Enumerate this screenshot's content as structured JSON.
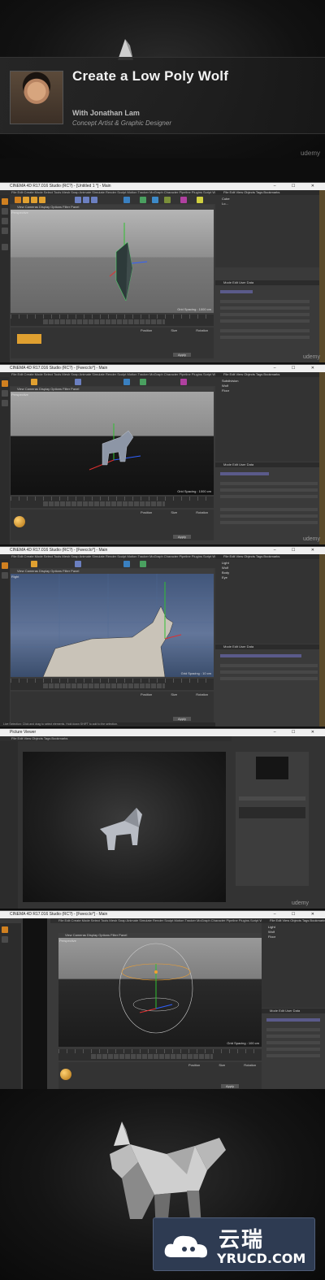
{
  "header": {
    "course_title": "Create a Low Poly Wolf",
    "instructor_line": "With Jonathan Lam",
    "instructor_role": "Concept Artist & Graphic Designer",
    "brand": "udemy"
  },
  "windows": [
    {
      "title": "CINEMA 4D R17.016 Studio (RC?) - [Untitled 1 *] - Main",
      "viewport_label": "Perspective",
      "grid_spacing": "Grid Spacing : 1000 cm",
      "om_rows": [
        "Cube",
        "Lo..."
      ],
      "brand": "udemy"
    },
    {
      "title": "CINEMA 4D R17.016 Studio (RC?) - [Fwecclo*] - Main",
      "viewport_label": "Perspective",
      "grid_spacing": "Grid Spacing : 1000 cm",
      "om_rows": [
        "Subdivision",
        "Wolf",
        "Floor"
      ],
      "brand": "udemy"
    },
    {
      "title": "CINEMA 4D R17.016 Studio (RC?) - [Fwecclo*] - Main",
      "viewport_label": "Right",
      "grid_spacing": "Grid Spacing : 10 cm",
      "om_rows": [
        "Light",
        "Wolf",
        "Body",
        "Eye"
      ],
      "brand": "udemy"
    },
    {
      "title": "Picture Viewer",
      "brand": "udemy"
    },
    {
      "title": "CINEMA 4D R17.016 Studio (RC?) - [Fwecclo*] - Main",
      "viewport_label": "Perspective",
      "grid_spacing": "Grid Spacing : 100 cm",
      "om_rows": [
        "Light",
        "Wolf",
        "Floor"
      ],
      "brand": "udemy"
    }
  ],
  "menu": "File  Edit  Create  Mode  Select  Tools  Mesh  Snap  Animate  Simulate  Render  Sculpt  Motion Tracker  MoGraph  Character  Pipeline  Plugins  Script  Window  Help",
  "viewport_menu": "View  Cameras  Display  Options  Filter  Panel",
  "om_menu": "File  Edit  View  Objects  Tags  Bookmarks",
  "attr_menu": "Mode  Edit  User Data",
  "coord_menu": "Position Size Rotation",
  "apply_label": "Apply",
  "status": "Live Selection: Click and drag to select elements. Hold down SHIFT to add to the selection.",
  "watermark": {
    "cn": "云瑞",
    "en": "YRUCD.COM"
  },
  "colors": {
    "accent": "#f0a030",
    "axis_x": "#e03030",
    "axis_y": "#30c030",
    "axis_z": "#3060ff"
  }
}
